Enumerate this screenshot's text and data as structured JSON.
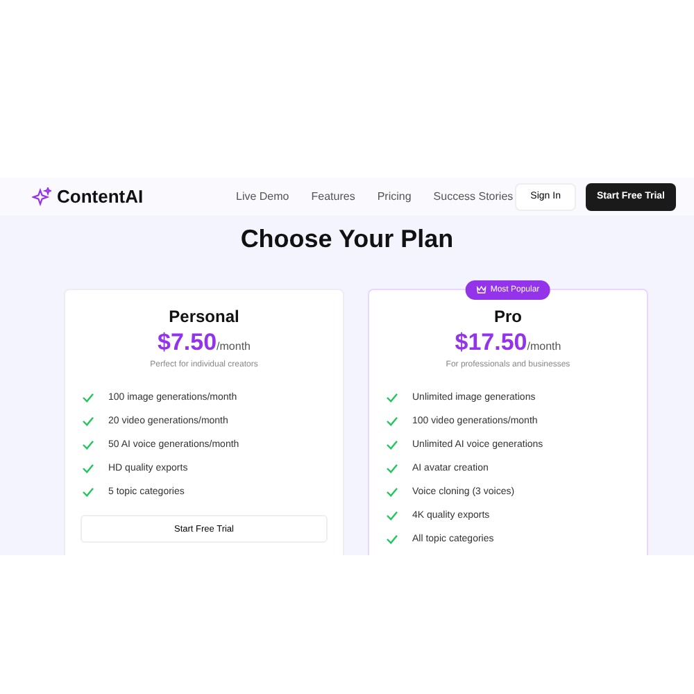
{
  "brand": {
    "name": "ContentAI"
  },
  "nav": {
    "links": [
      "Live Demo",
      "Features",
      "Pricing",
      "Success Stories"
    ],
    "sign_in": "Sign In",
    "cta": "Start Free Trial"
  },
  "heading": "Choose Your Plan",
  "plans": [
    {
      "name": "Personal",
      "price": "$7.50",
      "period": "/month",
      "description": "Perfect for individual creators",
      "featured": false,
      "features": [
        "100 image generations/month",
        "20 video generations/month",
        "50 AI voice generations/month",
        "HD quality exports",
        "5 topic categories"
      ],
      "button": "Start Free Trial"
    },
    {
      "name": "Pro",
      "badge": "Most Popular",
      "price": "$17.50",
      "period": "/month",
      "description": "For professionals and businesses",
      "featured": true,
      "features": [
        "Unlimited image generations",
        "100 video generations/month",
        "Unlimited AI voice generations",
        "AI avatar creation",
        "Voice cloning (3 voices)",
        "4K quality exports",
        "All topic categories"
      ]
    }
  ]
}
